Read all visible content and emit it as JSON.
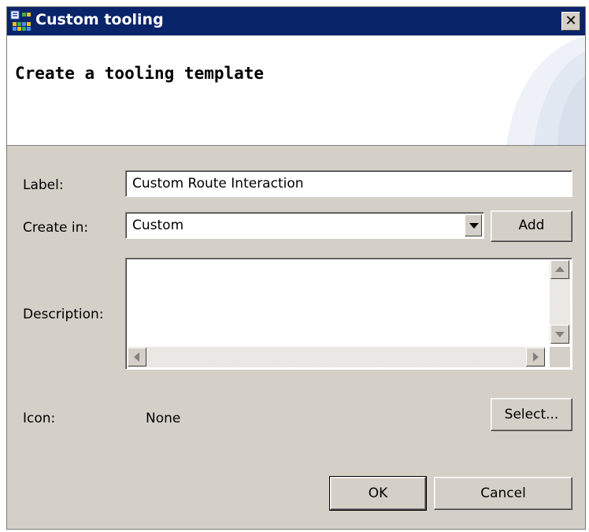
{
  "window": {
    "title": "Custom tooling",
    "close_label": "✕"
  },
  "header": {
    "title": "Create a tooling template"
  },
  "form": {
    "label_caption": "Label:",
    "label_value": "Custom Route Interaction",
    "create_in_caption": "Create in:",
    "create_in_value": "Custom",
    "add_label": "Add",
    "description_caption": "Description:",
    "description_value": "",
    "icon_caption": "Icon:",
    "icon_value": "None",
    "select_label": "Select..."
  },
  "footer": {
    "ok_label": "OK",
    "cancel_label": "Cancel"
  },
  "colors": {
    "titlebar": "#0a246a",
    "dialog_bg": "#d4d0c8"
  }
}
